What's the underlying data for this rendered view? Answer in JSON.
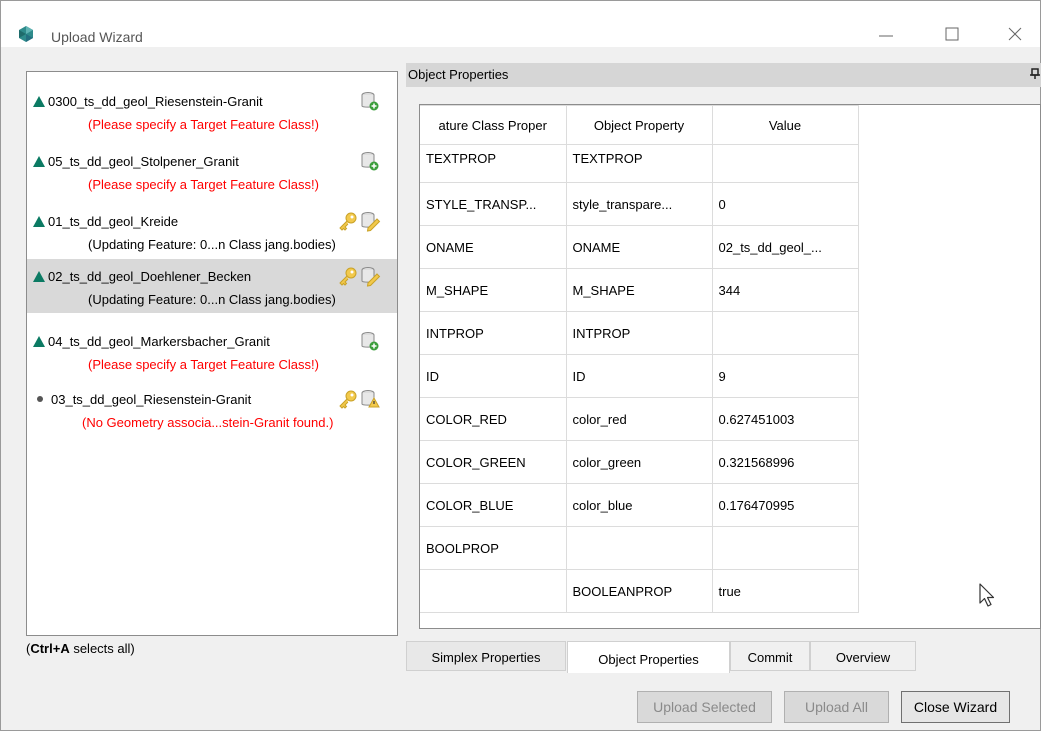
{
  "window": {
    "title": "Upload Wizard",
    "icon": "app-gem-icon"
  },
  "upload_list": {
    "items": [
      {
        "name": "0300_ts_dd_geol_Riesenstein-Granit",
        "status_icon": "triangle",
        "message": "(Please specify a Target Feature Class!)",
        "message_type": "error",
        "icons": [
          "add-db-icon"
        ]
      },
      {
        "name": "05_ts_dd_geol_Stolpener_Granit",
        "status_icon": "triangle",
        "message": "(Please specify a Target Feature Class!)",
        "message_type": "error",
        "icons": [
          "add-db-icon"
        ]
      },
      {
        "name": "01_ts_dd_geol_Kreide",
        "status_icon": "triangle",
        "message": "(Updating Feature: 0...n Class jang.bodies)",
        "message_type": "info",
        "icons": [
          "key-icon",
          "edit-db-icon"
        ]
      },
      {
        "name": "02_ts_dd_geol_Doehlener_Becken",
        "status_icon": "triangle",
        "message": "(Updating Feature: 0...n Class jang.bodies)",
        "message_type": "info",
        "icons": [
          "key-icon",
          "edit-db-icon"
        ],
        "selected": true
      },
      {
        "name": "04_ts_dd_geol_Markersbacher_Granit",
        "status_icon": "triangle",
        "message": "(Please specify a Target Feature Class!)",
        "message_type": "error",
        "icons": [
          "add-db-icon"
        ]
      },
      {
        "name": "03_ts_dd_geol_Riesenstein-Granit",
        "status_icon": "dot",
        "message": "(No Geometry associa...stein-Granit found.)",
        "message_type": "error",
        "icons": [
          "key-icon",
          "warning-db-icon"
        ]
      }
    ],
    "hint_bold": "Ctrl+A",
    "hint_rest": " selects all)",
    "hint_open": "("
  },
  "object_properties": {
    "panel_title": "Object Properties",
    "columns": [
      "ature Class Proper",
      "Object Property",
      "Value"
    ],
    "rows": [
      [
        "TEXTPROP",
        "TEXTPROP",
        ""
      ],
      [
        "STYLE_TRANSP...",
        "style_transpare...",
        "0"
      ],
      [
        "ONAME",
        "ONAME",
        "02_ts_dd_geol_..."
      ],
      [
        "M_SHAPE",
        "M_SHAPE",
        "344"
      ],
      [
        "INTPROP",
        "INTPROP",
        ""
      ],
      [
        "ID",
        "ID",
        "9"
      ],
      [
        "COLOR_RED",
        "color_red",
        "0.627451003"
      ],
      [
        "COLOR_GREEN",
        "color_green",
        "0.321568996"
      ],
      [
        "COLOR_BLUE",
        "color_blue",
        "0.176470995"
      ],
      [
        "BOOLPROP",
        "",
        ""
      ],
      [
        "",
        "BOOLEANPROP",
        "true"
      ]
    ]
  },
  "tabs": {
    "simplex": "Simplex Properties",
    "object": "Object Properties",
    "commit": "Commit",
    "overview": "Overview",
    "active": "object"
  },
  "buttons": {
    "upload_selected": "Upload Selected",
    "upload_all": "Upload All",
    "close_wizard": "Close Wizard"
  },
  "colors": {
    "error_text": "#ff0000",
    "ok_triangle": "#0b7a63",
    "selected_row": "#d9d9d9"
  }
}
